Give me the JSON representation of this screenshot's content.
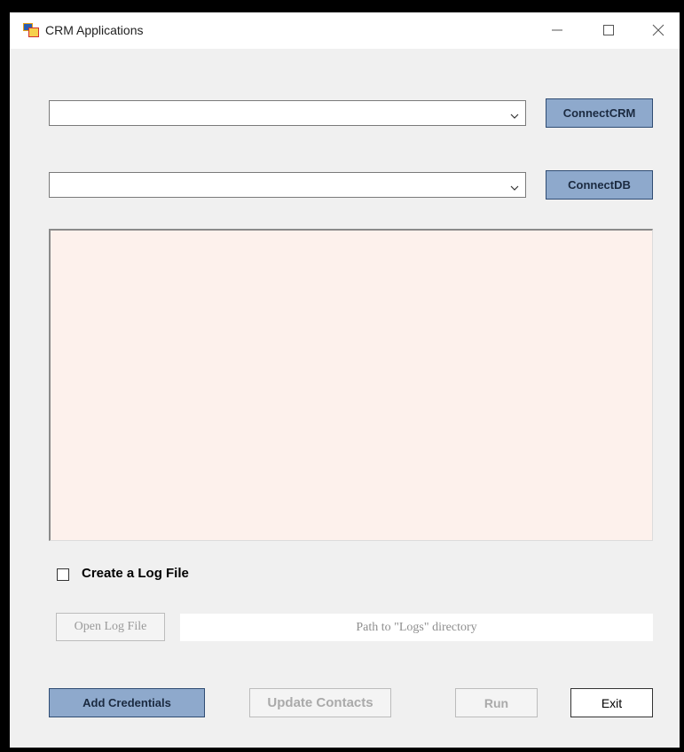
{
  "window": {
    "title": "CRM Applications",
    "icons": {
      "app": "app-window-icon",
      "minimize": "minimize-icon",
      "maximize": "maximize-icon",
      "close": "close-icon"
    }
  },
  "crm": {
    "selected": "",
    "button_label": "ConnectCRM"
  },
  "db": {
    "selected": "",
    "button_label": "ConnectDB"
  },
  "log_output": {
    "text": ""
  },
  "log_file": {
    "checkbox_label": "Create a Log File",
    "checked": false
  },
  "open_log": {
    "button_label": "Open Log File",
    "path_placeholder": "Path to \"Logs\" directory"
  },
  "footer": {
    "add_credentials": "Add Credentials",
    "update_contacts": "Update Contacts",
    "run": "Run",
    "exit": "Exit"
  },
  "colors": {
    "accent_button": "#8ea9cc",
    "log_background": "#fdf1ec",
    "window_background": "#f0f0f0"
  }
}
